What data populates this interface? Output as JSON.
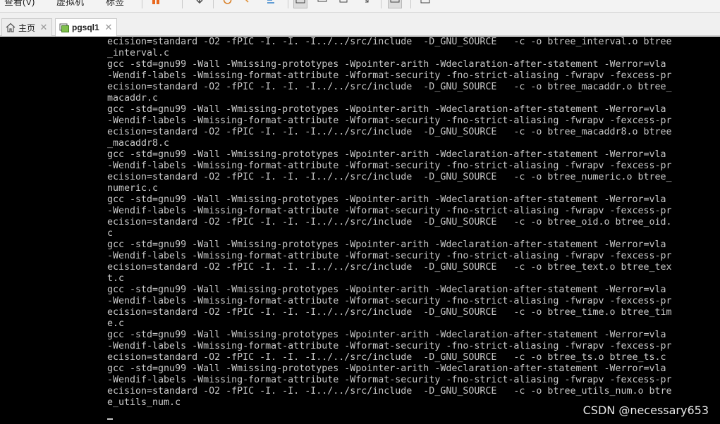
{
  "toolbar": {
    "menu_1": "查看(V)",
    "menu_2": "虚拟机",
    "menu_3": "标签"
  },
  "tabs": [
    {
      "label": "主页",
      "icon": "home-icon",
      "close": "✕"
    },
    {
      "label": "pgsql1",
      "icon": "vm-icon",
      "close": "✕"
    }
  ],
  "terminal": {
    "lines": [
      "ecision=standard -O2 -fPIC -I. -I. -I../../src/include  -D_GNU_SOURCE   -c -o btree_interval.o btree",
      "_interval.c",
      "gcc -std=gnu99 -Wall -Wmissing-prototypes -Wpointer-arith -Wdeclaration-after-statement -Werror=vla",
      "-Wendif-labels -Wmissing-format-attribute -Wformat-security -fno-strict-aliasing -fwrapv -fexcess-pr",
      "ecision=standard -O2 -fPIC -I. -I. -I../../src/include  -D_GNU_SOURCE   -c -o btree_macaddr.o btree_",
      "macaddr.c",
      "gcc -std=gnu99 -Wall -Wmissing-prototypes -Wpointer-arith -Wdeclaration-after-statement -Werror=vla",
      "-Wendif-labels -Wmissing-format-attribute -Wformat-security -fno-strict-aliasing -fwrapv -fexcess-pr",
      "ecision=standard -O2 -fPIC -I. -I. -I../../src/include  -D_GNU_SOURCE   -c -o btree_macaddr8.o btree",
      "_macaddr8.c",
      "gcc -std=gnu99 -Wall -Wmissing-prototypes -Wpointer-arith -Wdeclaration-after-statement -Werror=vla",
      "-Wendif-labels -Wmissing-format-attribute -Wformat-security -fno-strict-aliasing -fwrapv -fexcess-pr",
      "ecision=standard -O2 -fPIC -I. -I. -I../../src/include  -D_GNU_SOURCE   -c -o btree_numeric.o btree_",
      "numeric.c",
      "gcc -std=gnu99 -Wall -Wmissing-prototypes -Wpointer-arith -Wdeclaration-after-statement -Werror=vla",
      "-Wendif-labels -Wmissing-format-attribute -Wformat-security -fno-strict-aliasing -fwrapv -fexcess-pr",
      "ecision=standard -O2 -fPIC -I. -I. -I../../src/include  -D_GNU_SOURCE   -c -o btree_oid.o btree_oid.",
      "c",
      "gcc -std=gnu99 -Wall -Wmissing-prototypes -Wpointer-arith -Wdeclaration-after-statement -Werror=vla",
      "-Wendif-labels -Wmissing-format-attribute -Wformat-security -fno-strict-aliasing -fwrapv -fexcess-pr",
      "ecision=standard -O2 -fPIC -I. -I. -I../../src/include  -D_GNU_SOURCE   -c -o btree_text.o btree_tex",
      "t.c",
      "gcc -std=gnu99 -Wall -Wmissing-prototypes -Wpointer-arith -Wdeclaration-after-statement -Werror=vla",
      "-Wendif-labels -Wmissing-format-attribute -Wformat-security -fno-strict-aliasing -fwrapv -fexcess-pr",
      "ecision=standard -O2 -fPIC -I. -I. -I../../src/include  -D_GNU_SOURCE   -c -o btree_time.o btree_tim",
      "e.c",
      "gcc -std=gnu99 -Wall -Wmissing-prototypes -Wpointer-arith -Wdeclaration-after-statement -Werror=vla",
      "-Wendif-labels -Wmissing-format-attribute -Wformat-security -fno-strict-aliasing -fwrapv -fexcess-pr",
      "ecision=standard -O2 -fPIC -I. -I. -I../../src/include  -D_GNU_SOURCE   -c -o btree_ts.o btree_ts.c",
      "gcc -std=gnu99 -Wall -Wmissing-prototypes -Wpointer-arith -Wdeclaration-after-statement -Werror=vla",
      "-Wendif-labels -Wmissing-format-attribute -Wformat-security -fno-strict-aliasing -fwrapv -fexcess-pr",
      "ecision=standard -O2 -fPIC -I. -I. -I../../src/include  -D_GNU_SOURCE   -c -o btree_utils_num.o btre",
      "e_utils_num.c"
    ]
  },
  "watermark": "CSDN @necessary653",
  "colors": {
    "terminal_bg": "#000000",
    "terminal_fg": "#c8c8c8",
    "pause_icon": "#e8681e"
  }
}
